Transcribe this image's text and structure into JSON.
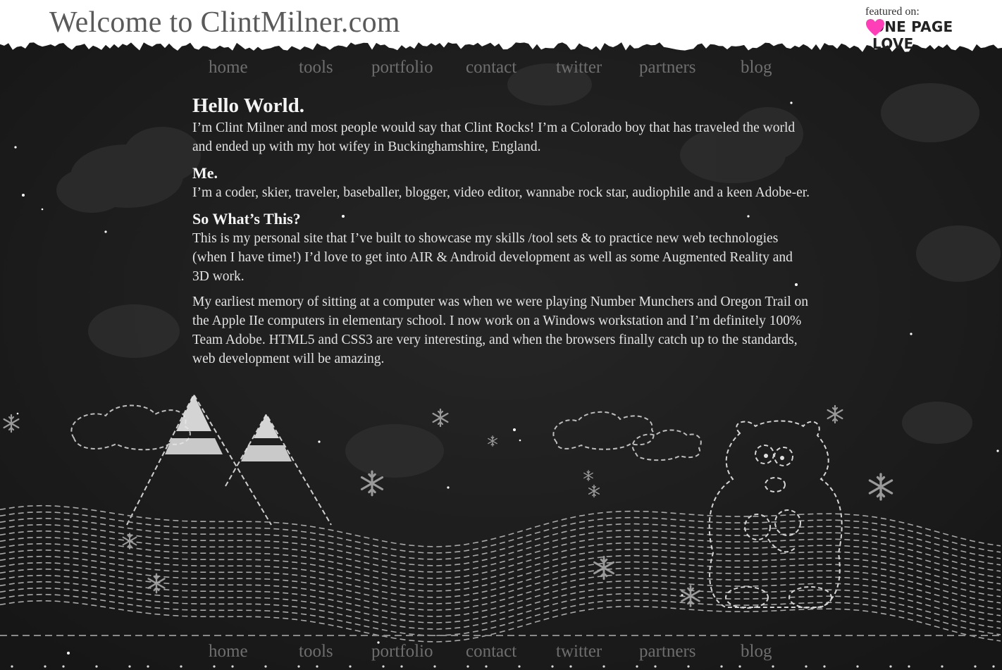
{
  "header": {
    "site_title": "Welcome to ClintMilner.com",
    "featured_label": "featured on:",
    "featured_brand": "ONE PAGE LOVE",
    "heart_icon": "heart-icon",
    "heart_color": "#ff3fb8"
  },
  "nav": {
    "items": [
      {
        "label": "home"
      },
      {
        "label": "tools"
      },
      {
        "label": "portfolio"
      },
      {
        "label": "contact"
      },
      {
        "label": "twitter"
      },
      {
        "label": "partners"
      },
      {
        "label": "blog"
      }
    ]
  },
  "content": {
    "hello_heading": "Hello World.",
    "hello_text": "I’m Clint Milner and most people would say that Clint Rocks! I’m a Colorado boy that has traveled the world and ended up with my hot wifey in Buckinghamshire, England.",
    "me_heading": "Me.",
    "me_text": "I’m a coder, skier, traveler, baseballer, blogger, video editor, wannabe rock star, audiophile and a keen Adobe-er.",
    "whats_heading": "So What’s This?",
    "whats_text": "This is my personal site that I’ve built to showcase my skills /tool sets & to practice new web technologies (when I have time!) I’d love to get into AIR & Android development as well as some Augmented Reality and 3D work.",
    "memory_text": "My earliest memory of sitting at a computer was when we were playing Number Munchers and Oregon Trail on the Apple IIe computers in elementary school. I now work on a Windows workstation and I’m definitely 100% Team Adobe. HTML5 and CSS3 are very interesting, and when the browsers finally catch up to the standards, web development will be amazing."
  },
  "illustration": {
    "elements": [
      "mountain-icon",
      "cloud-icon",
      "snowflake-icon",
      "polar-bear-icon",
      "star-icon",
      "rolling-hills"
    ]
  }
}
